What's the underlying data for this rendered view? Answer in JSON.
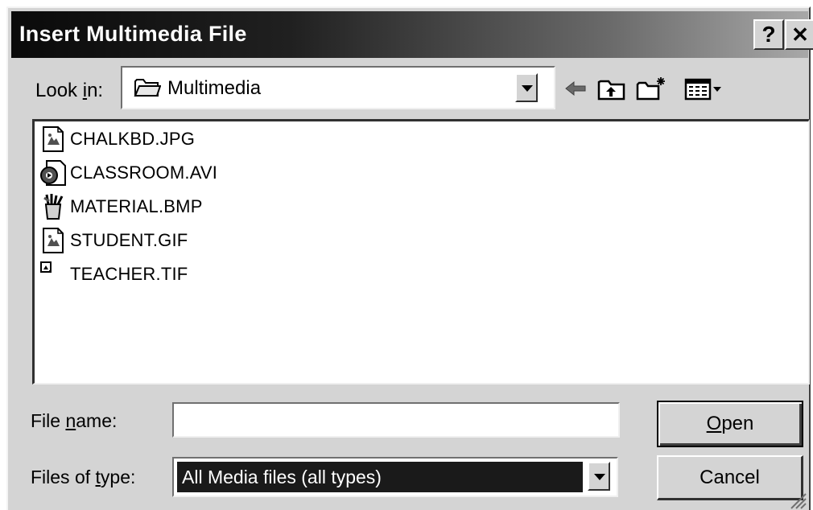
{
  "window": {
    "title": "Insert Multimedia File",
    "help_button": "?",
    "close_button": "✕"
  },
  "look_in": {
    "label_pre": "Look ",
    "label_accel": "i",
    "label_post": "n:",
    "value": "Multimedia",
    "icon": "folder-icon"
  },
  "toolbar": {
    "back_icon": "back-arrow-icon",
    "up_folder_icon": "up-folder-icon",
    "new_folder_icon": "new-folder-icon",
    "view_menu_icon": "view-menu-icon"
  },
  "files": [
    {
      "name": "CHALKBD.JPG",
      "icon": "jpg-image-icon"
    },
    {
      "name": "CLASSROOM.AVI",
      "icon": "video-file-icon"
    },
    {
      "name": "MATERIAL.BMP",
      "icon": "paint-bmp-icon"
    },
    {
      "name": "STUDENT.GIF",
      "icon": "gif-image-icon"
    },
    {
      "name": "TEACHER.TIF",
      "icon": "tif-image-icon"
    }
  ],
  "file_name": {
    "label_pre": "File ",
    "label_accel": "n",
    "label_post": "ame:",
    "value": ""
  },
  "file_type": {
    "label_pre": "Files of ",
    "label_accel": "t",
    "label_post": "ype:",
    "selected": "All Media files (all types)"
  },
  "buttons": {
    "open_accel": "O",
    "open_rest": "pen",
    "cancel": "Cancel"
  }
}
